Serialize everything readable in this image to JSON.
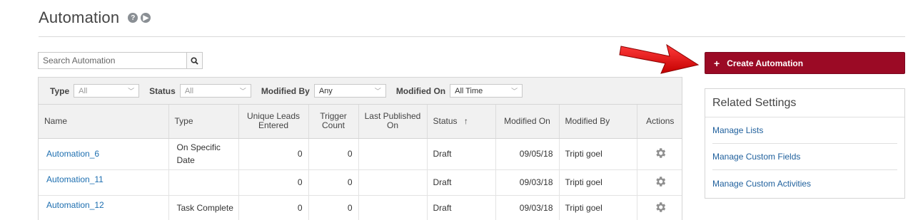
{
  "header": {
    "title": "Automation",
    "help_icon": "question-circle-icon",
    "video_icon": "play-circle-icon"
  },
  "search": {
    "placeholder": "Search Automation",
    "icon": "search-icon"
  },
  "filters": {
    "type": {
      "label": "Type",
      "value": "All"
    },
    "status": {
      "label": "Status",
      "value": "All"
    },
    "modified_by": {
      "label": "Modified By",
      "value": "Any"
    },
    "modified_on": {
      "label": "Modified On",
      "value": "All Time"
    }
  },
  "table": {
    "columns": [
      "Name",
      "Type",
      "Unique Leads Entered",
      "Trigger Count",
      "Last Published On",
      "Status",
      "Modified On",
      "Modified By",
      "Actions"
    ],
    "sort_indicator": "↑",
    "rows": [
      {
        "name": "Automation_6",
        "type": "On Specific Date",
        "unique_leads": "0",
        "trigger_count": "0",
        "last_published": "",
        "status": "Draft",
        "modified_on": "09/05/18",
        "modified_by": "Tripti goel"
      },
      {
        "name": "Automation_11",
        "type": "",
        "unique_leads": "0",
        "trigger_count": "0",
        "last_published": "",
        "status": "Draft",
        "modified_on": "09/03/18",
        "modified_by": "Tripti goel"
      },
      {
        "name": "Automation_12",
        "type": "Task Complete",
        "unique_leads": "0",
        "trigger_count": "0",
        "last_published": "",
        "status": "Draft",
        "modified_on": "09/03/18",
        "modified_by": "Tripti goel"
      }
    ]
  },
  "create_button": {
    "label": "Create Automation",
    "icon": "plus-icon"
  },
  "related_settings": {
    "title": "Related Settings",
    "items": [
      "Manage Lists",
      "Manage Custom Fields",
      "Manage Custom Activities"
    ]
  },
  "colors": {
    "accent": "#9b0a25",
    "link": "#1e6fb0",
    "arrow": "#e31b1b"
  }
}
